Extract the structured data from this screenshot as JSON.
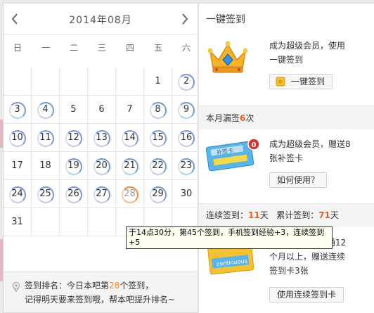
{
  "calendar": {
    "month_title": "2014年08月",
    "weekdays": [
      "日",
      "一",
      "二",
      "三",
      "四",
      "五",
      "六"
    ],
    "first_weekday": 5,
    "days_in_month": 31,
    "signed_days": [
      2,
      3,
      4,
      8,
      9,
      10,
      11,
      12,
      13,
      14,
      15,
      16,
      19,
      20,
      21,
      22,
      23,
      24,
      25,
      26,
      27,
      29
    ],
    "today": 28,
    "rank_line1_prefix": "签到排名：今日本吧第",
    "rank_number": "28",
    "rank_line1_suffix": "个签到，",
    "rank_line2": "记得明天要来签到哦，帮本吧提升排名~"
  },
  "tooltip": {
    "text": "于14点30分，第45个签到，手机签到经验+3，连续签到+5"
  },
  "side": {
    "one_key_title": "一键签到",
    "one_key_promo": [
      "成为超级会员，使用",
      "一键签到"
    ],
    "one_key_button": "一键签到",
    "missed_prefix": "本月漏签",
    "missed_count": "6",
    "missed_suffix": "次",
    "card_badge": "0",
    "card_text": "补签卡",
    "makeup_promo": [
      "成为超级会员，赠送8",
      "张补签卡"
    ],
    "how_to_button": "如何使用？",
    "streak_prefix": "连续签到：",
    "streak_days": "11",
    "streak_unit": "天",
    "total_prefix": "累计签到：",
    "total_days": "71",
    "total_unit": "天",
    "continuous_promo": [
      "开通12",
      "个月以上，赠送连续",
      "签到卡3张"
    ],
    "continuous_card_text": "continuous",
    "continuous_button": "使用连续签到卡"
  },
  "colors": {
    "accent_blue": "#6f9ad6",
    "today_orange": "#f08a38",
    "highlight_red": "#e85a2a"
  }
}
